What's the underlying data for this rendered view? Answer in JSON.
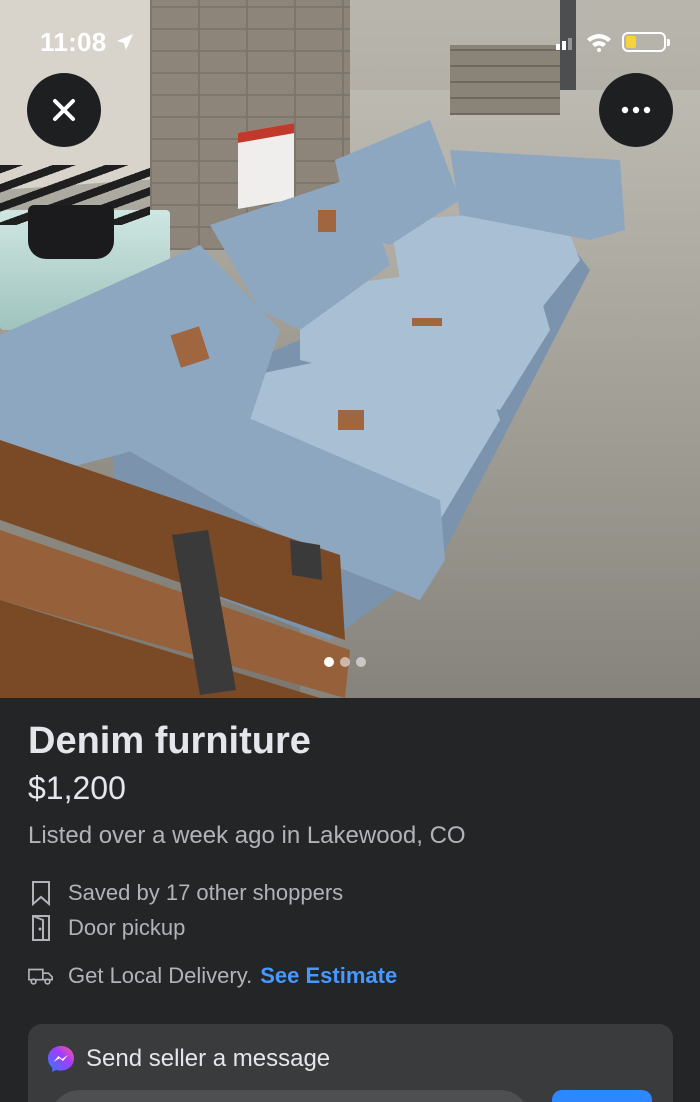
{
  "status_bar": {
    "time": "11:08"
  },
  "photo": {
    "carousel": {
      "total": 3,
      "active_index": 0
    }
  },
  "listing": {
    "title": "Denim furniture",
    "price": "$1,200",
    "listed_text": "Listed over a week ago in Lakewood, CO",
    "saved_text": "Saved by 17 other shoppers",
    "pickup_text": "Door pickup",
    "delivery_text": "Get Local Delivery.",
    "delivery_link": "See Estimate"
  },
  "message": {
    "title": "Send seller a message"
  },
  "colors": {
    "background": "#242526",
    "link": "#4599ff",
    "card": "#3a3b3c",
    "button": "#2d88ff"
  },
  "icons": {
    "close": "close-icon",
    "more": "more-icon",
    "bookmark": "bookmark-icon",
    "door": "door-icon",
    "truck": "truck-icon",
    "messenger": "messenger-icon"
  }
}
